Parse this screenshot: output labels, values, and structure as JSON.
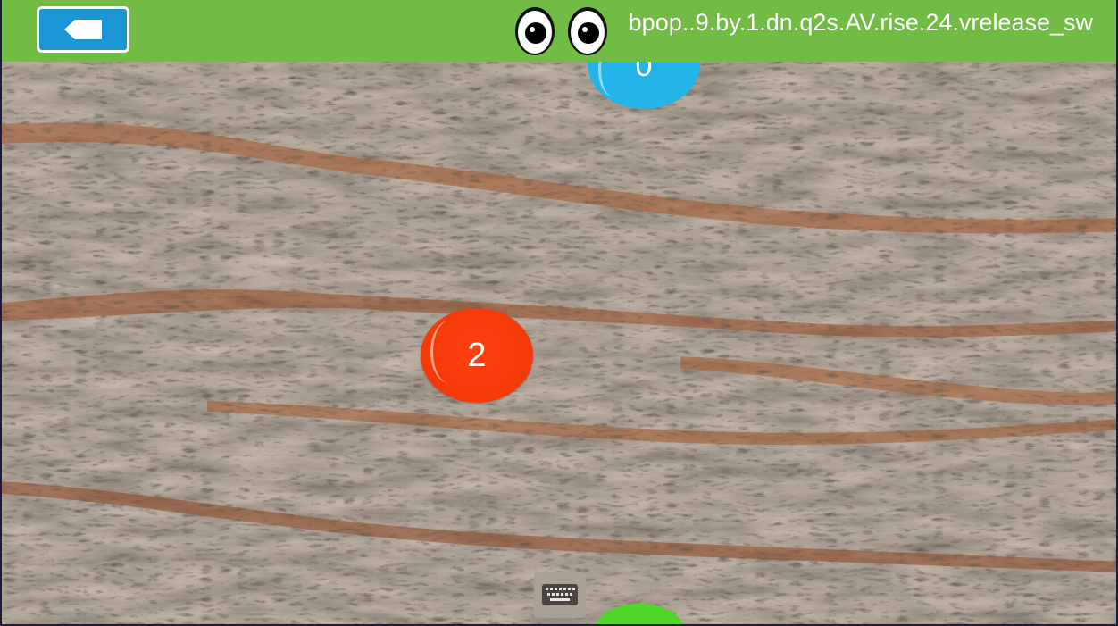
{
  "topbar": {
    "build_label": "bpop",
    "build_label_rest": "..9.by.1.dn.q2s.AV.rise.24.vrelease_sw",
    "color": "#72bb45"
  },
  "back_button": {
    "icon": "back-arrow-icon",
    "color": "#1a96d4"
  },
  "balls": {
    "red": {
      "label": "2",
      "color": "#f43a08"
    },
    "blue": {
      "label": "0",
      "color": "#23b5ea"
    },
    "green": {
      "label": "",
      "color": "#4fd628"
    }
  },
  "mascot": {
    "icon": "eyes-icon"
  },
  "keyboard": {
    "icon": "keyboard-icon"
  }
}
